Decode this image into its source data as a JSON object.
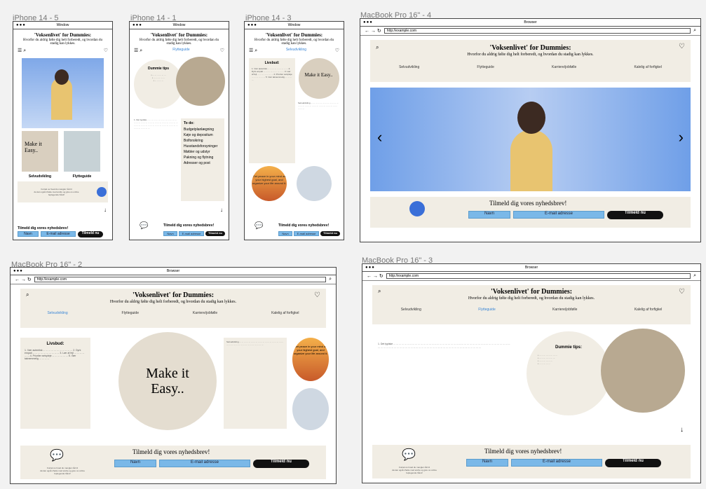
{
  "labels": {
    "p5": "iPhone 14 - 5",
    "p1": "iPhone 14 - 1",
    "p3": "iPhone 14 - 3",
    "m4": "MacBook Pro 16\" - 4",
    "m2": "MacBook Pro 16\" - 2",
    "m3": "MacBook Pro 16\" - 3"
  },
  "window_title": "Window",
  "browser_title": "Browser",
  "url": "http://example.com",
  "site": {
    "title": "'Voksenlivet' for Dummies:",
    "subtitle": "Hvorfor du aldrig følte dig helt forberedt, og hvordan du stadig kan lykkes.",
    "nav": [
      "Selvudvikling",
      "Flytteguide",
      "Karriere/jobfølle",
      "Kalelig af forfigkel"
    ]
  },
  "newsletter": {
    "title": "Tilmeld dig vores nyhedsbrev!",
    "name": "Navn",
    "email": "E-mail adresse",
    "submit": "Tilmeld nu"
  },
  "phone5": {
    "cards": [
      "Selvudvikling",
      "Flytteguide"
    ],
    "chat": "Fortæl os hvad du mangler råd til\nda kan også chatte med andre og give os online\nfeplegende hånd!"
  },
  "tips": {
    "title": "Dummie tips",
    "heading": "Dummie tips:"
  },
  "todo": {
    "title": "To do:",
    "items": [
      "Budgetplanlægning",
      "Køje og depositum",
      "Bolforsikring",
      "Husstandsforsyninger",
      "Møbler og udstyr",
      "Pakning og flytning",
      "Adresser og post"
    ]
  },
  "livsbud": {
    "title": "Livsbud:"
  },
  "made": "Make it Easy..",
  "peace": "Get peace in your mind as your highest goal, and organize your life around it."
}
